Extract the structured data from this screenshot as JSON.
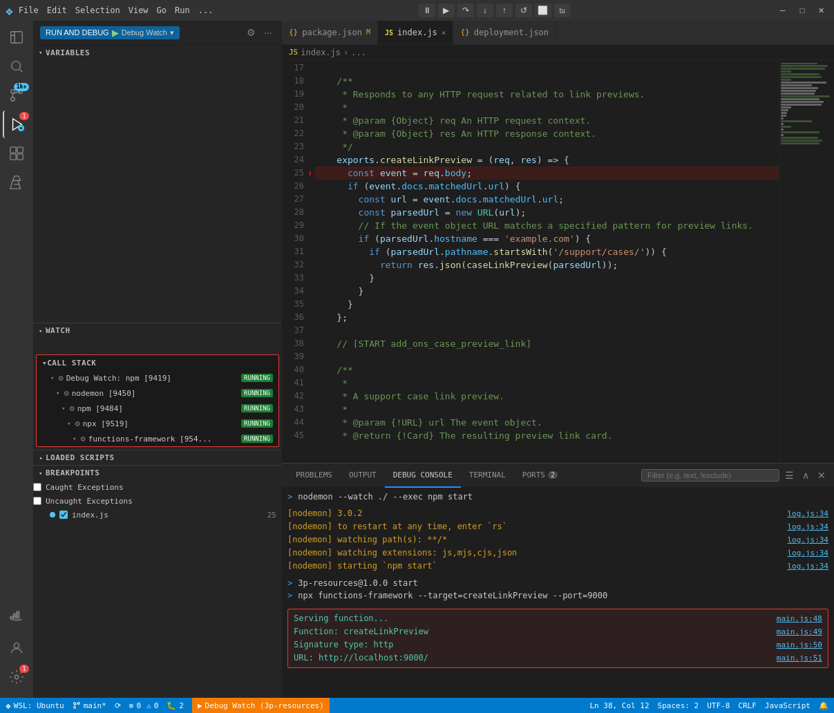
{
  "titlebar": {
    "logo": "VS",
    "menu": [
      "File",
      "Edit",
      "Selection",
      "View",
      "Go",
      "Run",
      "..."
    ],
    "debug_controls": [
      "⏸",
      "▶",
      "↩",
      "↪",
      "⬆",
      "↺",
      "⬜",
      "tu"
    ],
    "win_controls": [
      "─",
      "□",
      "✕"
    ]
  },
  "sidebar": {
    "run_debug_label": "RUN AND DEBUG",
    "debug_watch_label": "Debug Watch",
    "chevron_down": "▾",
    "sections": {
      "variables": "VARIABLES",
      "watch": "WATCH",
      "call_stack": "CALL STACK",
      "loaded_scripts": "LOADED SCRIPTS",
      "breakpoints": "BREAKPOINTS"
    },
    "call_stack_items": [
      {
        "indent": 0,
        "icon": "⚙",
        "label": "Debug Watch: npm [9419]",
        "status": "RUNNING"
      },
      {
        "indent": 1,
        "icon": "⚙",
        "label": "nodemon [9450]",
        "status": "RUNNING"
      },
      {
        "indent": 2,
        "icon": "⚙",
        "label": "npm [9484]",
        "status": "RUNNING"
      },
      {
        "indent": 3,
        "icon": "⚙",
        "label": "npx [9519]",
        "status": "RUNNING"
      },
      {
        "indent": 4,
        "icon": "⚙",
        "label": "functions-framework [954...",
        "status": "RUNNING"
      }
    ],
    "breakpoints": [
      {
        "type": "checkbox",
        "checked": false,
        "label": "Caught Exceptions"
      },
      {
        "type": "checkbox",
        "checked": false,
        "label": "Uncaught Exceptions"
      },
      {
        "type": "dot",
        "checked": true,
        "label": "index.js",
        "count": "25"
      }
    ]
  },
  "tabs": [
    {
      "icon": "{}",
      "label": "package.json",
      "modified": "M",
      "active": false
    },
    {
      "icon": "JS",
      "label": "index.js",
      "active": true,
      "close": "×"
    },
    {
      "icon": "{}",
      "label": "deployment.json",
      "active": false
    }
  ],
  "breadcrumb": {
    "items": [
      "JS index.js",
      ">",
      "..."
    ]
  },
  "code": {
    "lines": [
      {
        "num": 17,
        "content": ""
      },
      {
        "num": 18,
        "content": "    /**",
        "class": "c-comment"
      },
      {
        "num": 19,
        "content": "     * Responds to any HTTP request related to link previews.",
        "class": "c-comment"
      },
      {
        "num": 20,
        "content": "     *",
        "class": "c-comment"
      },
      {
        "num": 21,
        "content": "     * @param {Object} req An HTTP request context.",
        "class": "c-comment"
      },
      {
        "num": 22,
        "content": "     * @param {Object} res An HTTP response context.",
        "class": "c-comment"
      },
      {
        "num": 23,
        "content": "     */",
        "class": "c-comment"
      },
      {
        "num": 24,
        "content": "    exports.createLinkPreview = (req, res) => {",
        "class": "mixed"
      },
      {
        "num": 25,
        "content": "      const event = req.body;",
        "class": "mixed",
        "breakpoint": true
      },
      {
        "num": 26,
        "content": "      if (event.docs.matchedUrl.url) {",
        "class": "mixed"
      },
      {
        "num": 27,
        "content": "        const url = event.docs.matchedUrl.url;",
        "class": "mixed"
      },
      {
        "num": 28,
        "content": "        const parsedUrl = new URL(url);",
        "class": "mixed"
      },
      {
        "num": 29,
        "content": "        // If the event object URL matches a specified pattern for preview links.",
        "class": "c-comment"
      },
      {
        "num": 30,
        "content": "        if (parsedUrl.hostname === 'example.com') {",
        "class": "mixed"
      },
      {
        "num": 31,
        "content": "          if (parsedUrl.pathname.startsWith('/support/cases/')) {",
        "class": "mixed"
      },
      {
        "num": 32,
        "content": "            return res.json(caseLinkPreview(parsedUrl));",
        "class": "mixed"
      },
      {
        "num": 33,
        "content": "          }",
        "class": "c-op"
      },
      {
        "num": 34,
        "content": "        }",
        "class": "c-op"
      },
      {
        "num": 35,
        "content": "      }",
        "class": "c-op"
      },
      {
        "num": 36,
        "content": "    };",
        "class": "c-op"
      },
      {
        "num": 37,
        "content": ""
      },
      {
        "num": 38,
        "content": "    // [START add_ons_case_preview_link]",
        "class": "c-comment"
      },
      {
        "num": 39,
        "content": ""
      },
      {
        "num": 40,
        "content": "    /**",
        "class": "c-comment"
      },
      {
        "num": 41,
        "content": "     *",
        "class": "c-comment"
      },
      {
        "num": 42,
        "content": "     * A support case link preview.",
        "class": "c-comment"
      },
      {
        "num": 43,
        "content": "     *",
        "class": "c-comment"
      },
      {
        "num": 44,
        "content": "     * @param {!URL} url The event object.",
        "class": "c-comment"
      },
      {
        "num": 45,
        "content": "     * @return {!Card} The resulting preview link card.",
        "class": "c-comment"
      }
    ]
  },
  "panel": {
    "tabs": [
      "PROBLEMS",
      "OUTPUT",
      "DEBUG CONSOLE",
      "TERMINAL",
      "PORTS"
    ],
    "ports_badge": "2",
    "active_tab": "DEBUG CONSOLE",
    "filter_placeholder": "Filter (e.g. text, !exclude)",
    "console_lines": [
      {
        "type": "prompt",
        "text": "nodemon --watch ./ --exec npm start"
      },
      {
        "type": "blank"
      },
      {
        "type": "text",
        "text": "[nodemon] 3.0.2",
        "color": "yellow",
        "link": "log.js:34"
      },
      {
        "type": "text",
        "text": "[nodemon] to restart at any time, enter `rs`",
        "color": "yellow",
        "link": "log.js:34"
      },
      {
        "type": "text",
        "text": "[nodemon] watching path(s): **/*",
        "color": "yellow",
        "link": "log.js:34"
      },
      {
        "type": "text",
        "text": "[nodemon] watching extensions: js,mjs,cjs,json",
        "color": "yellow",
        "link": "log.js:34"
      },
      {
        "type": "text",
        "text": "[nodemon] starting `npm start`",
        "color": "yellow",
        "link": "log.js:34"
      },
      {
        "type": "blank"
      },
      {
        "type": "prompt",
        "text": "> 3p-resources@1.0.0 start"
      },
      {
        "type": "prompt",
        "text": "> npx functions-framework --target=createLinkPreview --port=9000"
      },
      {
        "type": "blank"
      },
      {
        "type": "highlight",
        "lines": [
          {
            "text": "Serving function...",
            "link": "main.js:48"
          },
          {
            "text": "Function: createLinkPreview",
            "link": "main.js:49"
          },
          {
            "text": "Signature type: http",
            "link": "main.js:50"
          },
          {
            "text": "URL: http://localhost:9000/",
            "link": "main.js:51"
          }
        ]
      }
    ]
  },
  "status_bar": {
    "wsl": "WSL: Ubuntu",
    "git_branch": "main*",
    "sync_icon": "⟳",
    "errors": "0",
    "warnings": "0",
    "debug": "2",
    "debug_label": "Debug Watch (3p-resources)",
    "ln": "Ln 38, Col 12",
    "spaces": "Spaces: 2",
    "encoding": "UTF-8",
    "line_ending": "CRLF",
    "language": "JavaScript"
  },
  "activity_bar": {
    "icons": [
      {
        "name": "explorer-icon",
        "glyph": "📄",
        "active": false
      },
      {
        "name": "search-icon",
        "glyph": "🔍",
        "active": false
      },
      {
        "name": "source-control-icon",
        "glyph": "⑂",
        "active": false,
        "badge": "1k+"
      },
      {
        "name": "run-debug-icon",
        "glyph": "▷",
        "active": true,
        "badge": "1"
      },
      {
        "name": "extensions-icon",
        "glyph": "⊞",
        "active": false
      },
      {
        "name": "testing-icon",
        "glyph": "⚗",
        "active": false
      },
      {
        "name": "docker-icon",
        "glyph": "🐳",
        "active": false
      }
    ]
  }
}
